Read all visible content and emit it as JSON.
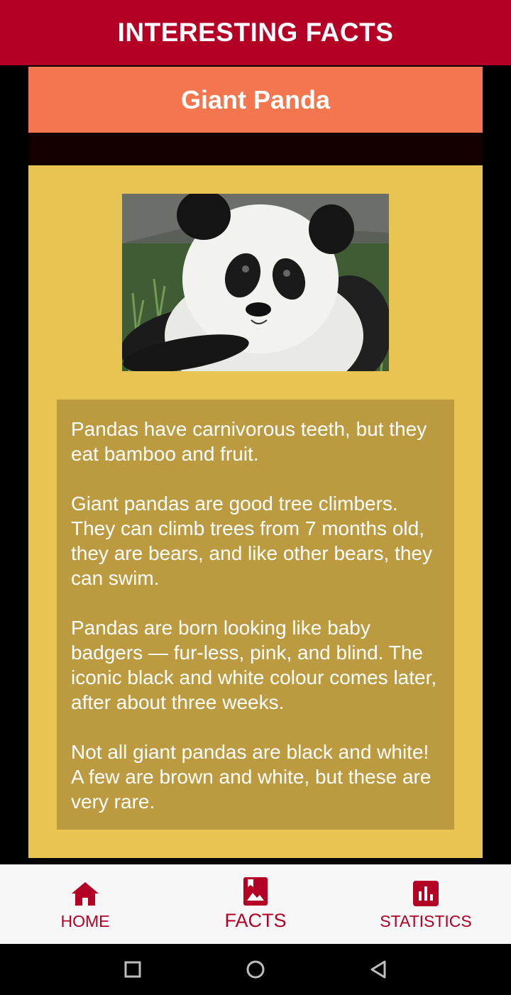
{
  "app": {
    "title": "INTERESTING FACTS"
  },
  "animal": {
    "name": "Giant Panda",
    "image_subject": "giant panda cub"
  },
  "facts": [
    "Pandas have carnivorous teeth, but they eat bamboo and fruit.",
    "Giant pandas are good tree climbers. They can climb trees from 7 months old, they are bears, and like other bears, they can swim.",
    "Pandas are born looking like baby badgers — fur-less, pink, and blind. The iconic black and white colour comes later, after about three weeks.",
    "Not all giant pandas are black and white! A few are brown and white, but these are very rare."
  ],
  "nav": {
    "items": [
      {
        "label": "HOME",
        "icon": "home-icon"
      },
      {
        "label": "FACTS",
        "icon": "photo-bookmark-icon",
        "active": true
      },
      {
        "label": "STATISTICS",
        "icon": "bar-chart-icon"
      }
    ]
  },
  "system_nav": {
    "icons": [
      "recents-square-icon",
      "home-circle-icon",
      "back-triangle-icon"
    ]
  },
  "colors": {
    "app_bar": "#b30024",
    "header": "#f4764e",
    "card": "#e8c452",
    "facts_box": "#bb9a40",
    "nav_accent": "#b30024"
  }
}
